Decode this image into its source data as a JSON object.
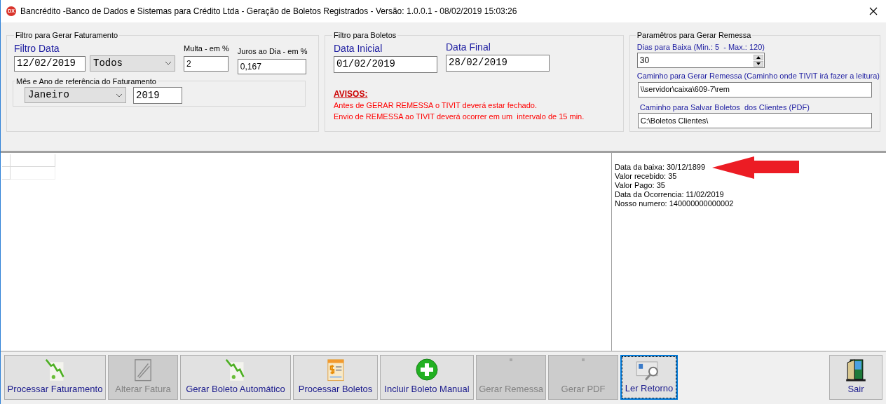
{
  "window": {
    "title": "Bancrédito -Banco de Dados e Sistemas para Crédito Ltda - Geração de Boletos Registrados - Versão: 1.0.0.1 - 08/02/2019 15:03:26",
    "logo": "DX"
  },
  "faturamento": {
    "title": "Filtro para Gerar Faturamento",
    "filtro_label": "Filtro Data",
    "date": "12/02/2019",
    "tipo": "Todos",
    "multa_label": "Multa - em %",
    "multa": "2",
    "juros_label": "Juros ao Dia - em %",
    "juros": "0,167",
    "referencia": {
      "title": "Mês e Ano de referência do Faturamento",
      "mes": "Janeiro",
      "ano": "2019"
    }
  },
  "boletos": {
    "title": "Filtro para Boletos",
    "inicial_label": "Data Inicial",
    "inicial": "01/02/2019",
    "final_label": "Data Final",
    "final": "28/02/2019",
    "avisos_title": "AVISOS:",
    "avisos": [
      "Antes de GERAR REMESSA o TIVIT deverá estar fechado.",
      "Envio de REMESSA ao TIVIT deverá ocorrer em um  intervalo de 15 min."
    ]
  },
  "remessa": {
    "title": "Paramêtros para Gerar Remessa",
    "dias_label": "Dias para Baixa (Min.: 5  - Max.: 120)",
    "dias": "30",
    "caminho_label": "Caminho para Gerar Remessa (Caminho onde TIVIT irá fazer a leitura)",
    "caminho": "\\\\servidor\\caixa\\609-7\\rem",
    "pdf_label": "Caminho para Salvar Boletos  dos Clientes (PDF)",
    "pdf": "C:\\Boletos Clientes\\"
  },
  "info_lines": [
    "Data da baixa: 30/12/1899",
    "Valor recebido: 35",
    "Valor Pago: 35",
    "Data da Ocorrencia: 11/02/2019",
    "Nosso numero: 140000000000002"
  ],
  "toolbar": [
    {
      "label": "Processar Faturamento",
      "kind": "chart",
      "disabled": false,
      "focused": false
    },
    {
      "label": "Alterar Fatura",
      "kind": "edit",
      "disabled": true,
      "focused": false
    },
    {
      "label": "Gerar Boleto Automático",
      "kind": "chart",
      "disabled": false,
      "focused": false
    },
    {
      "label": "Processar Boletos",
      "kind": "invoice",
      "disabled": false,
      "focused": false
    },
    {
      "label": "Incluir Boleto Manual",
      "kind": "plus",
      "disabled": false,
      "focused": false
    },
    {
      "label": "Gerar Remessa",
      "kind": "blank",
      "disabled": true,
      "focused": false
    },
    {
      "label": "Gerar PDF",
      "kind": "blank",
      "disabled": true,
      "focused": false
    },
    {
      "label": "Ler Retorno",
      "kind": "search",
      "disabled": false,
      "focused": true
    }
  ],
  "exit_button": {
    "label": "Sair"
  }
}
